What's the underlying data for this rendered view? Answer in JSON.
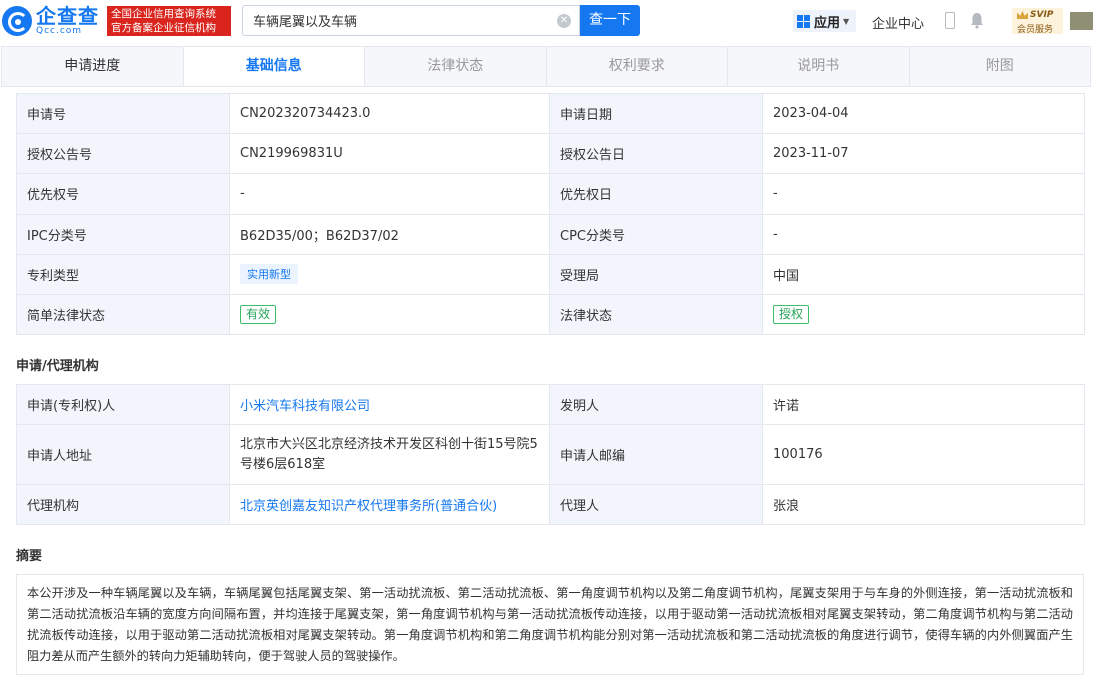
{
  "header": {
    "logo_cn": "企查查",
    "logo_en": "Qcc.com",
    "badge_line1": "全国企业信用查询系统",
    "badge_line2": "官方备案企业征信机构",
    "search_value": "车辆尾翼以及车辆",
    "search_button": "查一下",
    "apps_label": "应用",
    "center_label": "企业中心",
    "svip_top": "SVIP",
    "svip_bottom": "会员服务"
  },
  "tabs": [
    {
      "label": "申请进度"
    },
    {
      "label": "基础信息"
    },
    {
      "label": "法律状态"
    },
    {
      "label": "权利要求"
    },
    {
      "label": "说明书"
    },
    {
      "label": "附图"
    }
  ],
  "basic": {
    "rows": [
      {
        "k1": "申请号",
        "v1": "CN202320734423.0",
        "k2": "申请日期",
        "v2": "2023-04-04"
      },
      {
        "k1": "授权公告号",
        "v1": "CN219969831U",
        "k2": "授权公告日",
        "v2": "2023-11-07"
      },
      {
        "k1": "优先权号",
        "v1": "-",
        "k2": "优先权日",
        "v2": "-"
      },
      {
        "k1": "IPC分类号",
        "v1": "B62D35/00；B62D37/02",
        "k2": "CPC分类号",
        "v2": "-"
      },
      {
        "k1": "专利类型",
        "v1": "实用新型",
        "k2": "受理局",
        "v2": "中国"
      },
      {
        "k1": "简单法律状态",
        "v1": "有效",
        "k2": "法律状态",
        "v2": "授权"
      }
    ]
  },
  "agency": {
    "title": "申请/代理机构",
    "rows": [
      {
        "k1": "申请(专利权)人",
        "v1": "小米汽车科技有限公司",
        "k2": "发明人",
        "v2": "许诺"
      },
      {
        "k1": "申请人地址",
        "v1": "北京市大兴区北京经济技术开发区科创十街15号院5号楼6层618室",
        "k2": "申请人邮编",
        "v2": "100176"
      },
      {
        "k1": "代理机构",
        "v1": "北京英创嘉友知识产权代理事务所(普通合伙)",
        "k2": "代理人",
        "v2": "张浪"
      }
    ]
  },
  "abstract": {
    "title": "摘要",
    "text": "本公开涉及一种车辆尾翼以及车辆，车辆尾翼包括尾翼支架、第一活动扰流板、第二活动扰流板、第一角度调节机构以及第二角度调节机构，尾翼支架用于与车身的外侧连接，第一活动扰流板和第二活动扰流板沿车辆的宽度方向间隔布置，并均连接于尾翼支架，第一角度调节机构与第一活动扰流板传动连接，以用于驱动第一活动扰流板相对尾翼支架转动，第二角度调节机构与第二活动扰流板传动连接，以用于驱动第二活动扰流板相对尾翼支架转动。第一角度调节机构和第二角度调节机构能分别对第一活动扰流板和第二活动扰流板的角度进行调节，使得车辆的内外侧翼面产生阻力差从而产生额外的转向力矩辅助转向，便于驾驶人员的驾驶操作。"
  }
}
